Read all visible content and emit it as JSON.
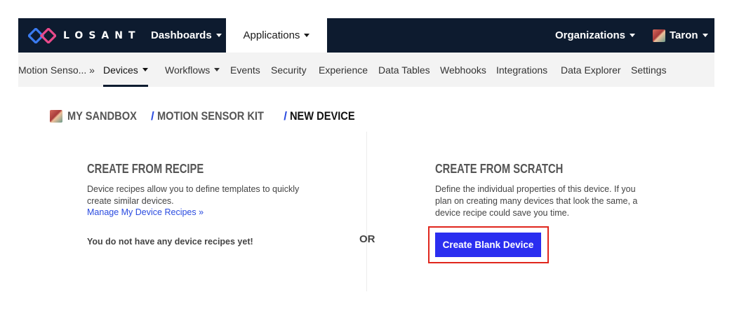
{
  "topbar": {
    "logo_text": "LOSANT",
    "nav": {
      "dashboards": "Dashboards",
      "applications": "Applications",
      "organizations": "Organizations",
      "user": "Taron"
    }
  },
  "subnav": {
    "items": [
      {
        "label": "Motion Senso... »"
      },
      {
        "label": "Devices"
      },
      {
        "label": "Workflows"
      },
      {
        "label": "Events"
      },
      {
        "label": "Security"
      },
      {
        "label": "Experience"
      },
      {
        "label": "Data Tables"
      },
      {
        "label": "Webhooks"
      },
      {
        "label": "Integrations"
      },
      {
        "label": "Data Explorer"
      },
      {
        "label": "Settings"
      }
    ]
  },
  "breadcrumb": {
    "sandbox": "MY SANDBOX",
    "app": "MOTION SENSOR KIT",
    "current": "NEW DEVICE",
    "separator": "/"
  },
  "recipe": {
    "title": "CREATE FROM RECIPE",
    "description": "Device recipes allow you to define templates to quickly create similar devices.",
    "manage_link": "Manage My Device Recipes »",
    "empty_text": "You do not have any device recipes yet!"
  },
  "or_label": "OR",
  "scratch": {
    "title": "CREATE FROM SCRATCH",
    "description": "Define the individual properties of this device. If you plan on creating many devices that look the same, a device recipe could save you time.",
    "button_label": "Create Blank Device"
  },
  "colors": {
    "topbar_bg": "#0d1b2f",
    "accent_blue": "#2a2ef0",
    "link_blue": "#2a4be0",
    "highlight_red": "#e0261d"
  }
}
